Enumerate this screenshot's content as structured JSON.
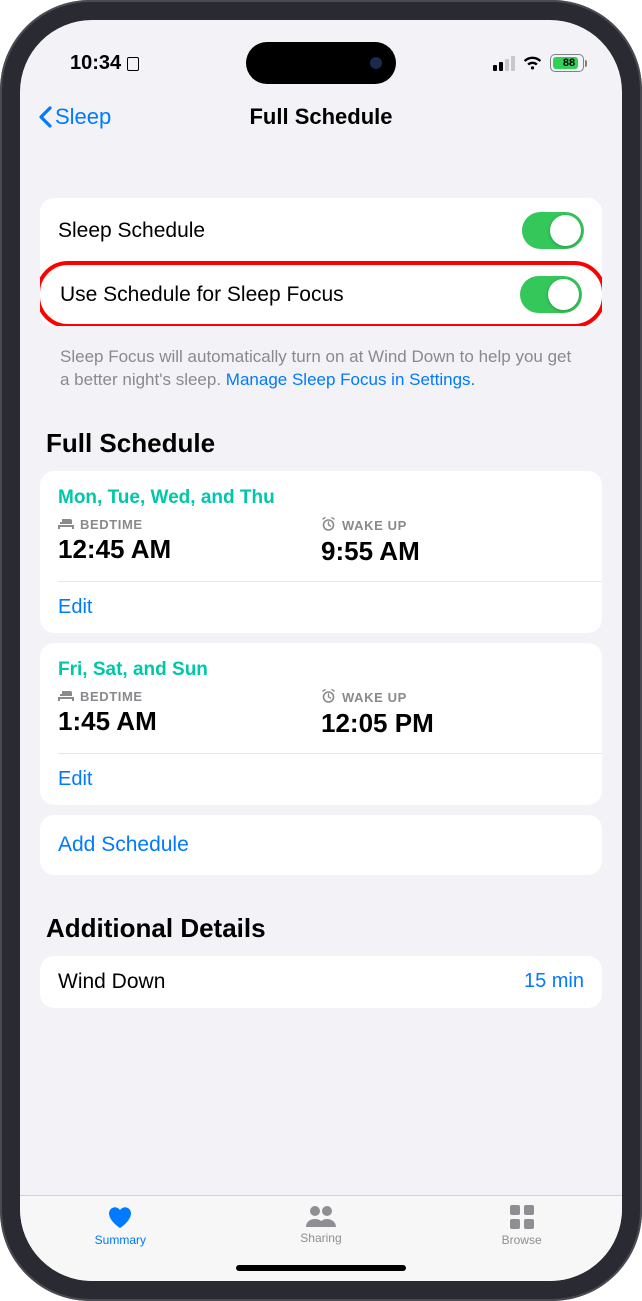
{
  "status": {
    "time": "10:34",
    "battery_pct": "88"
  },
  "nav": {
    "back_label": "Sleep",
    "title": "Full Schedule"
  },
  "toggles": {
    "sleep_schedule_label": "Sleep Schedule",
    "focus_label": "Use Schedule for Sleep Focus"
  },
  "footer": {
    "text": "Sleep Focus will automatically turn on at Wind Down to help you get a better night's sleep. ",
    "link": "Manage Sleep Focus in Settings."
  },
  "sections": {
    "full_schedule_header": "Full Schedule",
    "additional_header": "Additional Details"
  },
  "schedules": [
    {
      "days": "Mon, Tue, Wed, and Thu",
      "bedtime_label": "BEDTIME",
      "bedtime": "12:45 AM",
      "wake_label": "WAKE UP",
      "wake": "9:55 AM",
      "edit": "Edit"
    },
    {
      "days": "Fri, Sat, and Sun",
      "bedtime_label": "BEDTIME",
      "bedtime": "1:45 AM",
      "wake_label": "WAKE UP",
      "wake": "12:05 PM",
      "edit": "Edit"
    }
  ],
  "add_schedule": "Add Schedule",
  "wind_down": {
    "label": "Wind Down",
    "value": "15 min"
  },
  "tabs": {
    "summary": "Summary",
    "sharing": "Sharing",
    "browse": "Browse"
  }
}
